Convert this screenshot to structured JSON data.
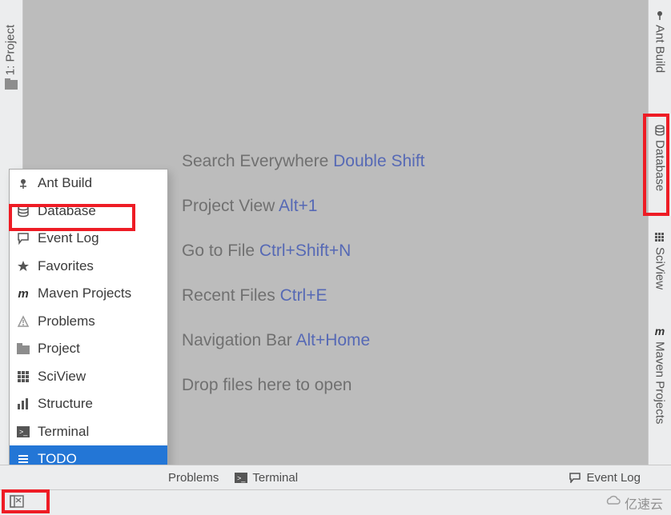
{
  "left_gutter": {
    "project_label": "1: Project"
  },
  "right_gutter": {
    "ant_build": "Ant Build",
    "database": "Database",
    "sciview": "SciView",
    "maven": "Maven Projects"
  },
  "hints": {
    "rows": [
      {
        "text": "Search Everywhere",
        "shortcut": "Double Shift"
      },
      {
        "text": "Project View",
        "shortcut": "Alt+1"
      },
      {
        "text": "Go to File",
        "shortcut": "Ctrl+Shift+N"
      },
      {
        "text": "Recent Files",
        "shortcut": "Ctrl+E"
      },
      {
        "text": "Navigation Bar",
        "shortcut": "Alt+Home"
      },
      {
        "text": "Drop files here to open",
        "shortcut": ""
      }
    ]
  },
  "popup": {
    "items": [
      {
        "name": "ant-build-item",
        "label": "Ant Build",
        "icon": "ant"
      },
      {
        "name": "database-item",
        "label": "Database",
        "icon": "db"
      },
      {
        "name": "event-log-item",
        "label": "Event Log",
        "icon": "circle"
      },
      {
        "name": "favorites-item",
        "label": "Favorites",
        "icon": "star"
      },
      {
        "name": "maven-projects-item",
        "label": "Maven Projects",
        "icon": "m"
      },
      {
        "name": "problems-item",
        "label": "Problems",
        "icon": "warn"
      },
      {
        "name": "project-item",
        "label": "Project",
        "icon": "folder"
      },
      {
        "name": "sciview-item",
        "label": "SciView",
        "icon": "grid"
      },
      {
        "name": "structure-item",
        "label": "Structure",
        "icon": "bars"
      },
      {
        "name": "terminal-item",
        "label": "Terminal",
        "icon": "term"
      },
      {
        "name": "todo-item",
        "label": "TODO",
        "icon": "list",
        "selected": true
      }
    ]
  },
  "status": {
    "problems": "Problems",
    "terminal": "Terminal",
    "event_log": "Event Log"
  },
  "watermark": "亿速云"
}
